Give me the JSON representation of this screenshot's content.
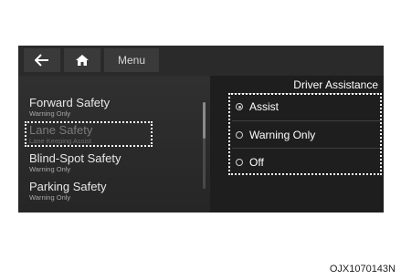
{
  "header": {
    "back_icon": "arrow-left-icon",
    "home_icon": "home-icon",
    "menu_label": "Menu"
  },
  "sidebar": {
    "items": [
      {
        "title": "Forward Safety",
        "subtitle": "Warning Only"
      },
      {
        "title": "Lane Safety",
        "subtitle": "Lane Keeping Assist"
      },
      {
        "title": "Blind-Spot Safety",
        "subtitle": "Warning Only"
      },
      {
        "title": "Parking Safety",
        "subtitle": "Warning Only"
      }
    ]
  },
  "panel": {
    "title": "Driver Assistance",
    "options": [
      {
        "label": "Assist",
        "selected": true
      },
      {
        "label": "Warning Only",
        "selected": false
      },
      {
        "label": "Off",
        "selected": false
      }
    ]
  },
  "caption": "OJX1070143N",
  "colors": {
    "screen_bg": "#1e1e1e",
    "highlight_box": "#ffffff",
    "text": "#ffffff"
  }
}
